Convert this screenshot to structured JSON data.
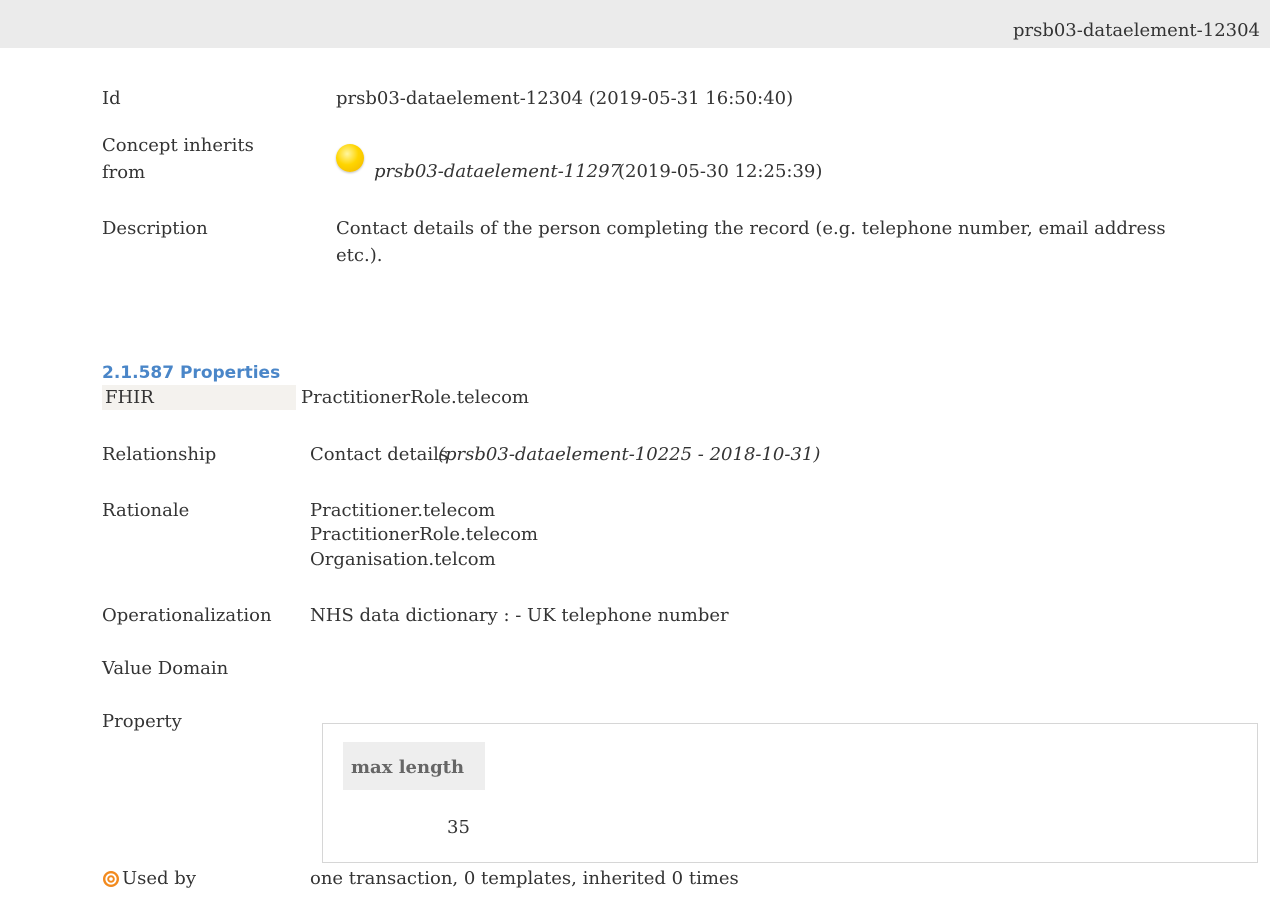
{
  "header": {
    "element_id": "prsb03-dataelement-12304"
  },
  "details": {
    "id_label": "Id",
    "id_value": "prsb03-dataelement-12304 (2019-05-31 16:50:40)",
    "inherits_label_line1": "Concept inherits",
    "inherits_label_line2": "from",
    "inherits_link": "prsb03-dataelement-11297",
    "inherits_date": "(2019-05-30 12:25:39)",
    "description_label": "Description",
    "description_value": "Contact details of the person completing the record (e.g. telephone number, email address etc.)."
  },
  "properties": {
    "section_title": "2.1.587 Properties",
    "fhir_label": "FHIR",
    "fhir_value": "PractitionerRole.telecom",
    "relationship_label": "Relationship",
    "relationship_value": "Contact details",
    "relationship_ref": "(prsb03-dataelement-10225 - 2018-10-31)",
    "rationale_label": "Rationale",
    "rationale_lines": [
      "Practitioner.telecom",
      "PractitionerRole.telecom",
      "Organisation.telcom"
    ],
    "operationalization_label": "Operationalization",
    "operationalization_value": "NHS data dictionary : - UK telephone number",
    "value_domain_label": "Value Domain",
    "property_label": "Property",
    "property_table": {
      "header": "max length",
      "value": "35"
    },
    "used_by_label": "Used by",
    "used_by_value": "one transaction, 0 templates, inherited 0 times"
  },
  "colors": {
    "accent": "#4a86c8",
    "status_dot": "#ffd500",
    "used_by_icon": "#f28a1e"
  },
  "icons": {
    "status": "yellow-status-dot-icon",
    "used_by": "target-icon"
  }
}
